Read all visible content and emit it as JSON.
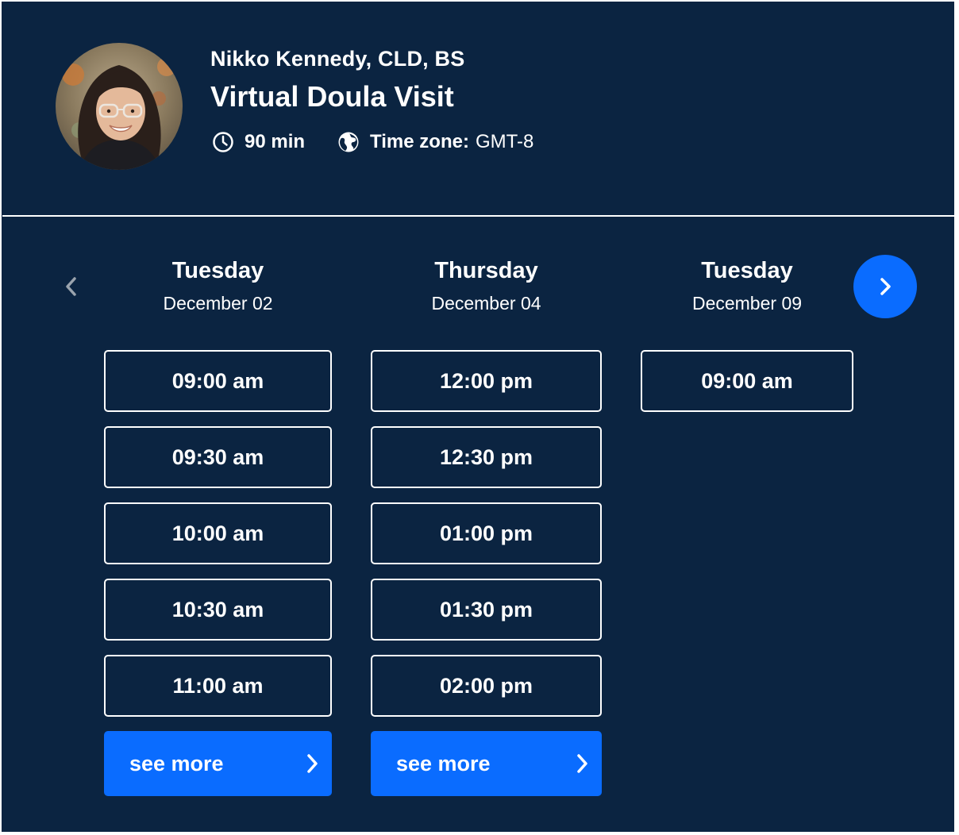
{
  "provider": {
    "name": "Nikko Kennedy, CLD, BS",
    "service": "Virtual Doula Visit",
    "duration": "90 min",
    "timezone_label": "Time zone:",
    "timezone_value": "GMT-8"
  },
  "icons": {
    "duration": "clock-icon",
    "timezone": "globe-icon",
    "prev": "chevron-left-icon",
    "next": "chevron-right-icon"
  },
  "colors": {
    "background": "#0b2441",
    "accent": "#0a6cff",
    "text": "#ffffff"
  },
  "days": [
    {
      "day": "Tuesday",
      "date": "December 02",
      "slots": [
        "09:00 am",
        "09:30 am",
        "10:00 am",
        "10:30 am",
        "11:00 am"
      ],
      "see_more": "see more"
    },
    {
      "day": "Thursday",
      "date": "December 04",
      "slots": [
        "12:00 pm",
        "12:30 pm",
        "01:00 pm",
        "01:30 pm",
        "02:00 pm"
      ],
      "see_more": "see more"
    },
    {
      "day": "Tuesday",
      "date": "December 09",
      "slots": [
        "09:00 am"
      ]
    }
  ]
}
